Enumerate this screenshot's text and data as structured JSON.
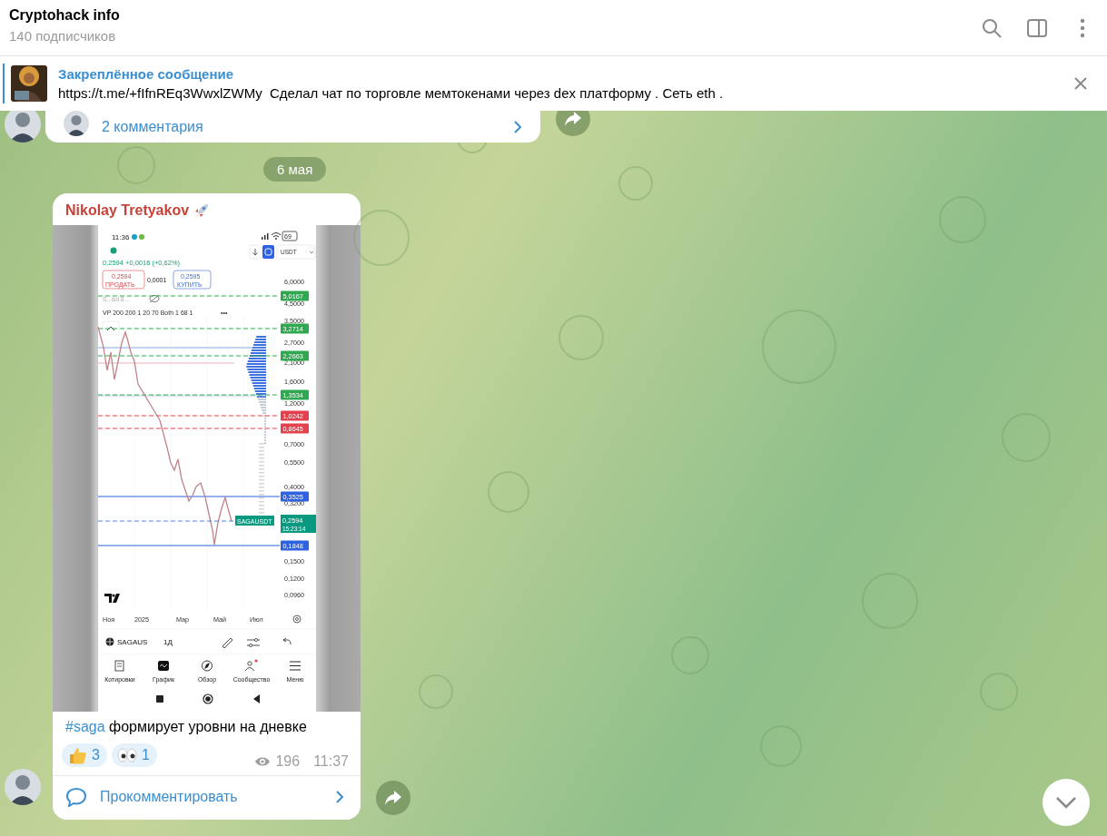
{
  "header": {
    "title": "Cryptohack info",
    "subtitle": "140 подписчиков"
  },
  "pinned": {
    "label": "Закреплённое сообщение",
    "text": "https://t.me/+fIfnREq3WwxlZWMy  Сделал чат по торговле мемтокенами через dex платформу . Сеть eth ."
  },
  "previous_post": {
    "comments": "2 комментария"
  },
  "date": "6 мая",
  "post": {
    "author": "Nikolay Tretyakov",
    "image": {
      "time": "11:36",
      "battery": "69",
      "quote": "0,2594 +0,0016 (+0,62%)",
      "sell": {
        "price": "0,2594",
        "label": "ПРОДАТЬ"
      },
      "spread": "0,0001",
      "buy": {
        "price": "0,2595",
        "label": "КУПИТЬ"
      },
      "currency": "USDT",
      "indicator": "S...sol 8...",
      "volume_profile": "VP 200 200 1 20 70 Both 1 68 1",
      "more": "•••",
      "axis": [
        "6,0000",
        "4,5000",
        "3,5000",
        "2,7000",
        "2,1000",
        "1,6000",
        "1,2000",
        "0,7000",
        "0,5500",
        "0,4000",
        "0,3200",
        "0,1500",
        "0,1200",
        "0,0960"
      ],
      "price_tags": [
        {
          "label": "5,0167",
          "color": "#2fa84f",
          "kind": "dashed"
        },
        {
          "label": "3,2714",
          "color": "#2fa84f",
          "kind": "dashed"
        },
        {
          "label": "2,2663",
          "color": "#2fa84f",
          "kind": "dashed"
        },
        {
          "label": "1,3534",
          "color": "#2fa84f",
          "kind": "dashed"
        },
        {
          "label": "1,0242",
          "color": "#e5404d",
          "kind": "dashed"
        },
        {
          "label": "0,8645",
          "color": "#e5404d",
          "kind": "dashed"
        },
        {
          "label": "0,3525",
          "color": "#2f62e0",
          "kind": "solid"
        },
        {
          "label": "0,1848",
          "color": "#2f62e0",
          "kind": "solid"
        }
      ],
      "symbol_tag": "SAGAUSDT",
      "last_price": "0,2594",
      "countdown": "15:23:14",
      "months": [
        "Ноя",
        "2025",
        "Мар",
        "Май",
        "Июл"
      ],
      "symbol": "SAGAUS",
      "interval": "1Д",
      "nav": [
        "Котировки",
        "График",
        "Обзор",
        "Сообщество",
        "Меню"
      ]
    },
    "hashtag": "#saga",
    "caption": " формирует уровни на дневке",
    "reactions": [
      {
        "kind": "thumbs",
        "count": "3"
      },
      {
        "kind": "eyes",
        "count": "1"
      }
    ],
    "views": "196",
    "time": "11:37",
    "comment_button": "Прокомментировать"
  }
}
